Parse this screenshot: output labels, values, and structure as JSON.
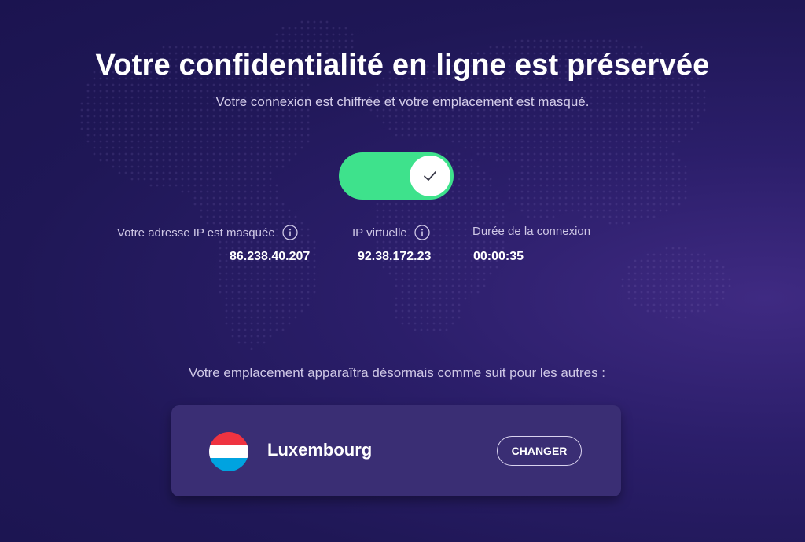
{
  "header": {
    "title": "Votre confidentialité en ligne est préservée",
    "subtitle": "Votre connexion est chiffrée et votre emplacement est masqué."
  },
  "toggle": {
    "state": "on",
    "icon": "check-icon",
    "color": "#3ee28c"
  },
  "stats": {
    "ip": {
      "label": "Votre adresse IP est masquée",
      "value": "86.238.40.207",
      "icon": "info-icon"
    },
    "virtual_ip": {
      "label": "IP virtuelle",
      "value": "92.38.172.23",
      "icon": "info-icon"
    },
    "duration": {
      "label": "Durée de la connexion",
      "value": "00:00:35"
    }
  },
  "location": {
    "caption": "Votre emplacement apparaîtra désormais comme suit pour les autres :",
    "country": "Luxembourg",
    "flag_icon": "luxembourg-flag-icon",
    "flag_colors": [
      "#ef3340",
      "#ffffff",
      "#00a3e0"
    ],
    "change_label": "CHANGER"
  },
  "colors": {
    "background": "#231a5e",
    "card": "#3a2e74",
    "accent": "#3ee28c"
  }
}
